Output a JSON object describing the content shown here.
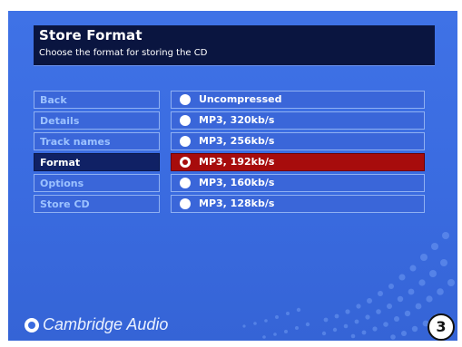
{
  "header": {
    "title": "Store Format",
    "subtitle": "Choose the format for storing the CD"
  },
  "menu": {
    "items": [
      {
        "label": "Back"
      },
      {
        "label": "Details"
      },
      {
        "label": "Track names"
      },
      {
        "label": "Format",
        "active": true
      },
      {
        "label": "Options"
      },
      {
        "label": "Store CD"
      }
    ]
  },
  "formats": {
    "options": [
      {
        "label": "Uncompressed"
      },
      {
        "label": "MP3, 320kb/s"
      },
      {
        "label": "MP3, 256kb/s"
      },
      {
        "label": "MP3, 192kb/s",
        "selected": true
      },
      {
        "label": "MP3, 160kb/s"
      },
      {
        "label": "MP3, 128kb/s"
      }
    ]
  },
  "brand": {
    "name": "Cambridge Audio"
  },
  "page_badge": "3",
  "colors": {
    "background": "#3a6be0",
    "title_bar": "#0a1540",
    "menu_active": "#102165",
    "selected": "#a70c0c"
  }
}
